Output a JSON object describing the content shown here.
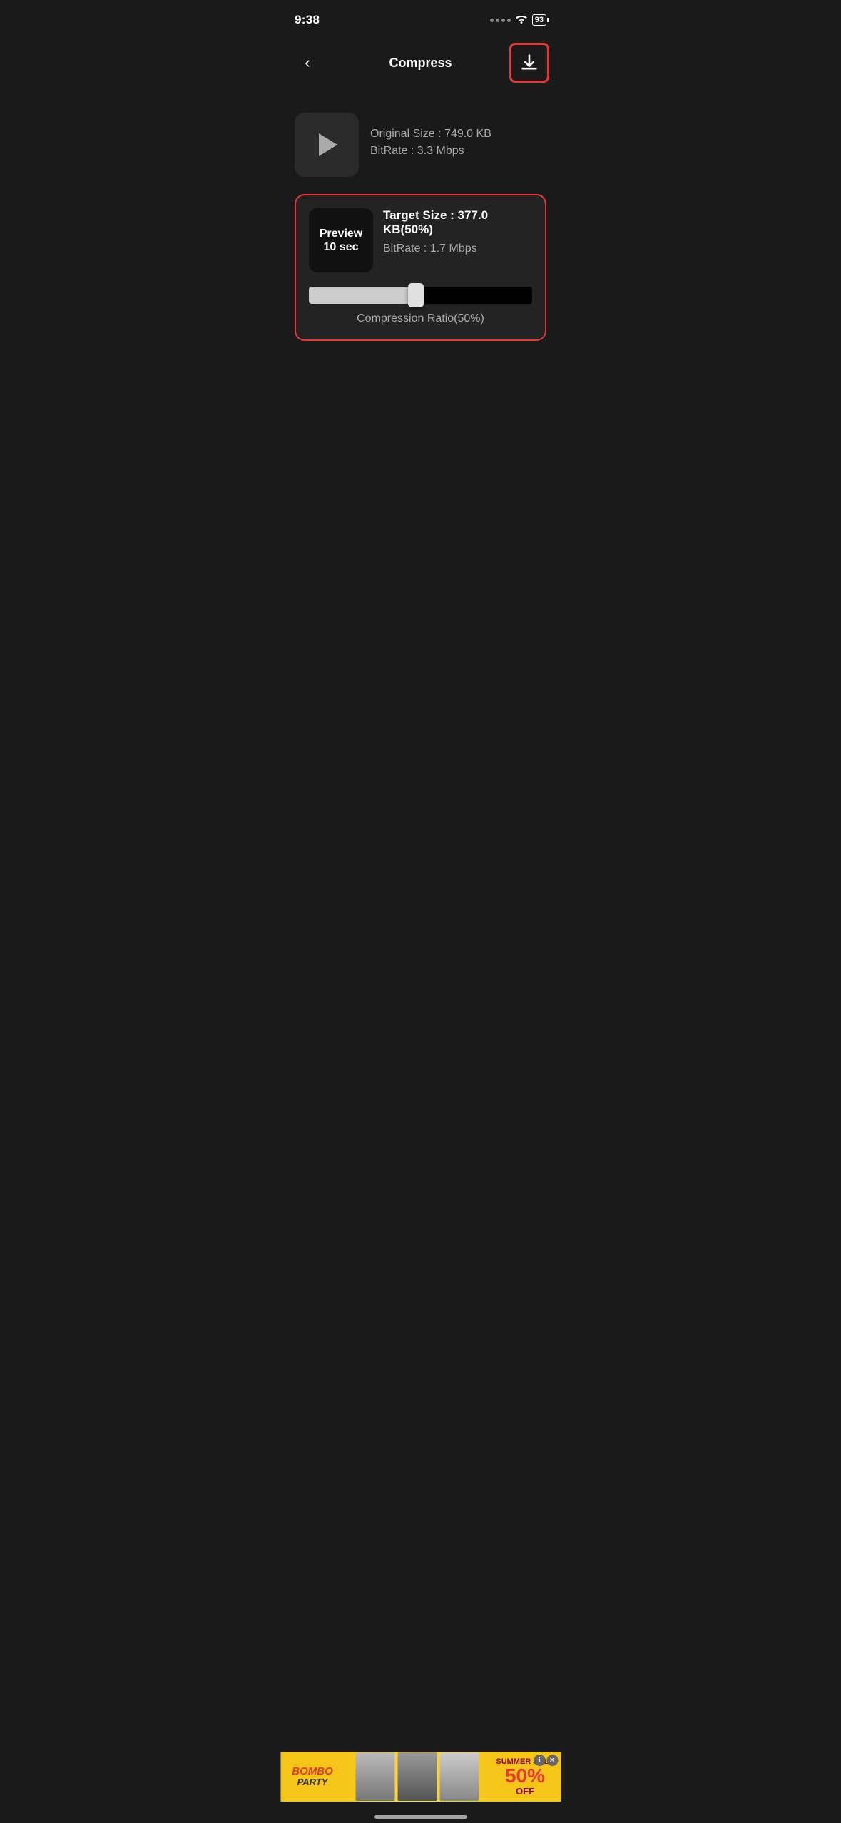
{
  "status_bar": {
    "time": "9:38",
    "battery": "93",
    "signal": "····",
    "wifi": "wifi"
  },
  "header": {
    "title": "Compress",
    "back_label": "<",
    "download_label": "download"
  },
  "original_video": {
    "original_size_label": "Original Size : 749.0 KB",
    "bitrate_label": "BitRate : 3.3 Mbps"
  },
  "compressed_video": {
    "preview_line1": "Preview",
    "preview_line2": "10 sec",
    "target_size_label": "Target Size : 377.0 KB(50%)",
    "bitrate_label": "BitRate : 1.7 Mbps",
    "slider_value": 50,
    "compression_ratio_label": "Compression Ratio(50%)"
  },
  "ad": {
    "logo": "Bombo Party",
    "sale_text": "SUMMER SALE",
    "percent": "50%",
    "off": "OFF"
  }
}
